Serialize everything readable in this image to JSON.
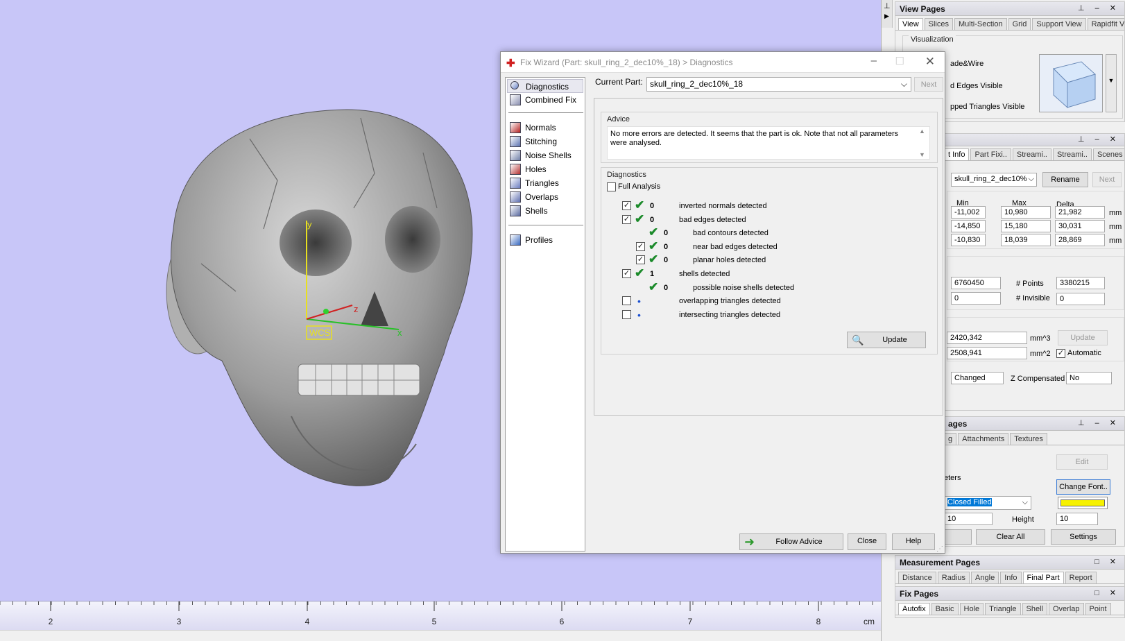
{
  "ruler": {
    "unit": "cm",
    "ticks": [
      "2",
      "3",
      "4",
      "5",
      "6",
      "7",
      "8"
    ]
  },
  "viewport": {
    "wcs_label": "WCS",
    "axis_y": "y",
    "axis_z": "z",
    "axis_x": "x"
  },
  "dialog": {
    "title": "Fix Wizard (Part: skull_ring_2_dec10%_18) > Diagnostics",
    "nav": [
      {
        "label": "Diagnostics",
        "icon": "magnifier-icon"
      },
      {
        "label": "Combined Fix",
        "icon": "combined-fix-icon"
      },
      {
        "label": "Normals",
        "icon": "normals-cube-icon"
      },
      {
        "label": "Stitching",
        "icon": "stitching-cube-icon"
      },
      {
        "label": "Noise Shells",
        "icon": "noise-shells-icon"
      },
      {
        "label": "Holes",
        "icon": "holes-cube-icon"
      },
      {
        "label": "Triangles",
        "icon": "triangles-cube-icon"
      },
      {
        "label": "Overlaps",
        "icon": "overlaps-cube-icon"
      },
      {
        "label": "Shells",
        "icon": "shells-cube-icon"
      },
      {
        "label": "Profiles",
        "icon": "document-icon"
      }
    ],
    "current_part_label": "Current Part:",
    "current_part_value": "skull_ring_2_dec10%_18",
    "next_label": "Next",
    "advice_label": "Advice",
    "advice_text": "No more errors are detected. It seems that the part is ok. Note that not all parameters were analysed.",
    "diagnostics_label": "Diagnostics",
    "full_analysis_label": "Full Analysis",
    "rows": [
      {
        "checked": true,
        "status": "ok",
        "count": "0",
        "text": "inverted normals detected"
      },
      {
        "checked": true,
        "status": "ok",
        "count": "0",
        "text": "bad edges detected"
      },
      {
        "checked": null,
        "status": "ok",
        "count": "0",
        "text": "bad contours detected"
      },
      {
        "checked": true,
        "status": "ok",
        "count": "0",
        "text": "near bad edges detected"
      },
      {
        "checked": true,
        "status": "ok",
        "count": "0",
        "text": "planar holes detected"
      },
      {
        "checked": true,
        "status": "ok",
        "count": "1",
        "text": "shells detected"
      },
      {
        "checked": null,
        "status": "ok",
        "count": "0",
        "text": "possible noise shells detected"
      },
      {
        "checked": false,
        "status": "none",
        "count": "",
        "text": "overlapping triangles detected"
      },
      {
        "checked": false,
        "status": "none",
        "count": "",
        "text": "intersecting triangles detected"
      }
    ],
    "update_label": "Update",
    "follow_advice_label": "Follow Advice",
    "close_label": "Close",
    "help_label": "Help"
  },
  "view_pages": {
    "title": "View Pages",
    "tabs": [
      "View",
      "Slices",
      "Multi-Section",
      "Grid",
      "Support View",
      "Rapidfit View"
    ],
    "visualization_label": "Visualization",
    "opt1": "ade&Wire",
    "opt2": "d Edges Visible",
    "opt3": "pped Triangles Visible"
  },
  "part_pages": {
    "tabs": [
      "t Info",
      "Part Fixi..",
      "Streami..",
      "Streami..",
      "Scenes"
    ],
    "part_select": "skull_ring_2_dec10%",
    "rename_label": "Rename",
    "next_label": "Next",
    "col_min": "Min",
    "col_max": "Max",
    "col_delta": "Delta",
    "rows": [
      {
        "min": "-11,002",
        "max": "10,980",
        "delta": "21,982",
        "unit": "mm"
      },
      {
        "min": "-14,850",
        "max": "15,180",
        "delta": "30,031",
        "unit": "mm"
      },
      {
        "min": "-10,830",
        "max": "18,039",
        "delta": "28,869",
        "unit": "mm"
      }
    ],
    "triangles": "6760450",
    "points_label": "# Points",
    "points": "3380215",
    "invalid": "0",
    "invisible_label": "# Invisible",
    "invisible": "0",
    "volume": "2420,342",
    "volume_unit": "mm^3",
    "update_label": "Update",
    "area": "2508,941",
    "area_unit": "mm^2",
    "automatic_label": "Automatic",
    "status": "Changed",
    "zcomp_label": "Z Compensated",
    "zcomp_value": "No"
  },
  "label_pages": {
    "title": "ages",
    "tabs": [
      "g",
      "Attachments",
      "Textures"
    ],
    "edit_label": "Edit",
    "params_label": "eters",
    "change_font_label": "Change Font..",
    "style_value": "Closed Filled",
    "width_value": "10",
    "height_label": "Height",
    "height_value": "10",
    "clear_all_label": "Clear All",
    "settings_label": "Settings",
    "swatch_color": "#f6f100"
  },
  "measurement_pages": {
    "title": "Measurement Pages",
    "tabs": [
      "Distance",
      "Radius",
      "Angle",
      "Info",
      "Final Part",
      "Report"
    ]
  },
  "fix_pages": {
    "title": "Fix Pages",
    "tabs": [
      "Autofix",
      "Basic",
      "Hole",
      "Triangle",
      "Shell",
      "Overlap",
      "Point"
    ]
  },
  "colors": {
    "viewport_bg": "#c8c6f8",
    "check_green": "#1b8a2a",
    "wcs_yellow": "#e8e020"
  }
}
